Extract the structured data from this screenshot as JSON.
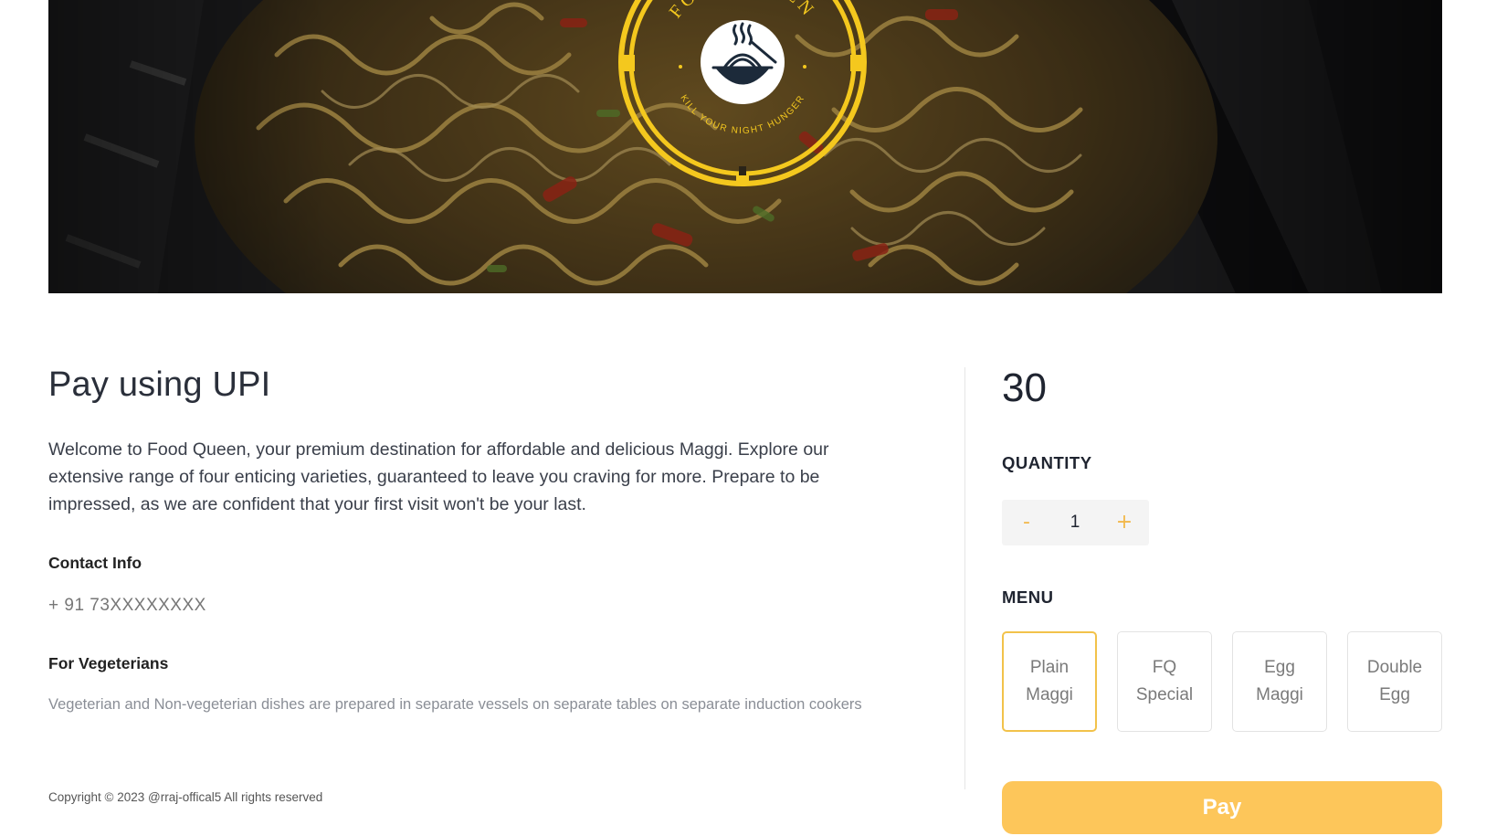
{
  "hero": {
    "logo": {
      "brand": "FOOD QUEEN",
      "tagline": "KILL YOUR NIGHT HUNGER",
      "icon": "noodle-bowl-icon",
      "ring_color": "#f4c81e"
    }
  },
  "left": {
    "title": "Pay using UPI",
    "description": "Welcome to Food Queen, your premium destination for affordable and delicious Maggi. Explore our extensive range of four enticing varieties, guaranteed to leave you craving for more. Prepare to be impressed, as we are confident that your first visit won't be your last.",
    "contact_heading": "Contact Info",
    "phone": "+ 91 73XXXXXXXX",
    "veg_heading": "For Vegeterians",
    "veg_text": "Vegeterian and Non-vegeterian dishes are prepared in separate vessels on separate tables on separate induction cookers"
  },
  "footer": {
    "copyright": "Copyright © 2023 @rraj-offical5 All rights reserved"
  },
  "right": {
    "price": "30",
    "quantity_label": "QUANTITY",
    "quantity": {
      "minus": "-",
      "value": "1",
      "plus": "+"
    },
    "menu_label": "MENU",
    "menu_items": [
      {
        "line1": "Plain",
        "line2": "Maggi",
        "selected": true
      },
      {
        "line1": "FQ",
        "line2": "Special",
        "selected": false
      },
      {
        "line1": "Egg",
        "line2": "Maggi",
        "selected": false
      },
      {
        "line1": "Double",
        "line2": "Egg",
        "selected": false
      }
    ],
    "pay_label": "Pay",
    "accent_color": "#fdc65a"
  }
}
